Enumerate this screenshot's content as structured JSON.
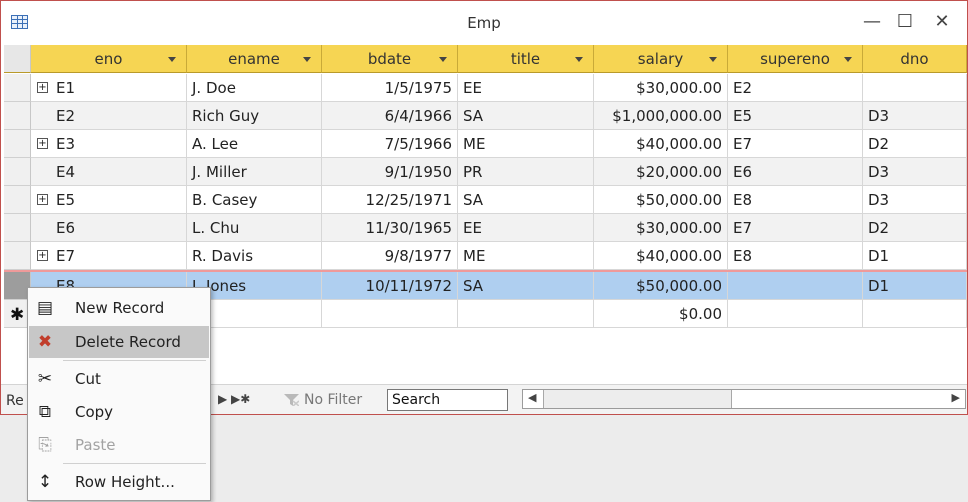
{
  "window": {
    "title": "Emp",
    "minimize": "—",
    "maximize": "☐",
    "close": "✕"
  },
  "columns": [
    {
      "label": "eno",
      "dropdown": true
    },
    {
      "label": "ename",
      "dropdown": true
    },
    {
      "label": "bdate",
      "dropdown": true
    },
    {
      "label": "title",
      "dropdown": true
    },
    {
      "label": "salary",
      "dropdown": true
    },
    {
      "label": "supereno",
      "dropdown": true
    },
    {
      "label": "dno",
      "dropdown": false
    }
  ],
  "rows": [
    {
      "eno": "E1",
      "ename": "J. Doe",
      "bdate": "1/5/1975",
      "title": "EE",
      "salary": "$30,000.00",
      "supereno": "E2",
      "dno": ""
    },
    {
      "eno": "E2",
      "ename": "Rich Guy",
      "bdate": "6/4/1966",
      "title": "SA",
      "salary": "$1,000,000.00",
      "supereno": "E5",
      "dno": "D3"
    },
    {
      "eno": "E3",
      "ename": "A. Lee",
      "bdate": "7/5/1966",
      "title": "ME",
      "salary": "$40,000.00",
      "supereno": "E7",
      "dno": "D2"
    },
    {
      "eno": "E4",
      "ename": "J. Miller",
      "bdate": "9/1/1950",
      "title": "PR",
      "salary": "$20,000.00",
      "supereno": "E6",
      "dno": "D3"
    },
    {
      "eno": "E5",
      "ename": "B. Casey",
      "bdate": "12/25/1971",
      "title": "SA",
      "salary": "$50,000.00",
      "supereno": "E8",
      "dno": "D3"
    },
    {
      "eno": "E6",
      "ename": "L. Chu",
      "bdate": "11/30/1965",
      "title": "EE",
      "salary": "$30,000.00",
      "supereno": "E7",
      "dno": "D2"
    },
    {
      "eno": "E7",
      "ename": "R. Davis",
      "bdate": "9/8/1977",
      "title": "ME",
      "salary": "$40,000.00",
      "supereno": "E8",
      "dno": "D1"
    },
    {
      "eno": "E8",
      "ename": "J. Jones",
      "bdate": "10/11/1972",
      "title": "SA",
      "salary": "$50,000.00",
      "supereno": "",
      "dno": "D1"
    }
  ],
  "new_row": {
    "salary": "$0.00"
  },
  "record_nav": {
    "label": "Re",
    "filter": "No Filter",
    "search": "Search"
  },
  "context_menu": [
    {
      "label": "New Record",
      "icon": "new-record-icon",
      "hover": false,
      "disabled": false
    },
    {
      "label": "Delete Record",
      "icon": "delete-record-icon",
      "hover": true,
      "disabled": false
    },
    {
      "label": "Cut",
      "icon": "scissors-icon",
      "hover": false,
      "disabled": false
    },
    {
      "label": "Copy",
      "icon": "copy-icon",
      "hover": false,
      "disabled": false
    },
    {
      "label": "Paste",
      "icon": "paste-icon",
      "hover": false,
      "disabled": true
    },
    {
      "label": "Row Height...",
      "icon": "row-height-icon",
      "hover": false,
      "disabled": false
    }
  ],
  "colors": {
    "header": "#f6d553",
    "selected_row": "#afcff0",
    "window_border": "#c0504d"
  }
}
